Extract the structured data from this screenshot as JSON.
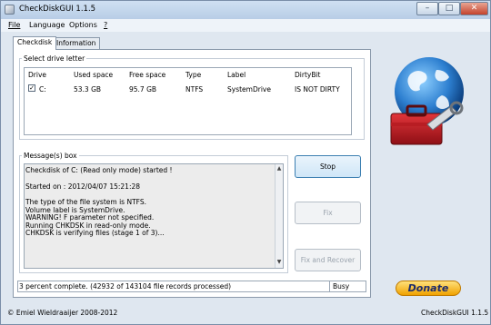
{
  "window": {
    "title": "CheckDiskGUI 1.1.5",
    "min_label": "–",
    "max_label": "□",
    "close_label": "✕"
  },
  "menu": [
    {
      "label": "File",
      "access": "F"
    },
    {
      "label": "Language",
      "access": "L"
    },
    {
      "label": "Options",
      "access": "O"
    },
    {
      "label": "?",
      "access": "?"
    }
  ],
  "tabs": [
    {
      "label": "Checkdisk"
    },
    {
      "label": "Information"
    }
  ],
  "drive_group": {
    "title": "Select drive letter",
    "columns": [
      "Drive",
      "Used space",
      "Free space",
      "Type",
      "Label",
      "DirtyBit"
    ],
    "rows": [
      {
        "checked": true,
        "drive": "C:",
        "used": "53.3 GB",
        "free": "95.7 GB",
        "type": "NTFS",
        "label": "SystemDrive",
        "dirtybit": "IS NOT DIRTY"
      }
    ]
  },
  "message_group": {
    "title": "Message(s) box",
    "lines": [
      "Checkdisk of C: (Read only mode) started !",
      "",
      "Started on : 2012/04/07 15:21:28",
      "",
      "The type of the file system is NTFS.",
      "Volume label is SystemDrive.",
      "WARNING!  F parameter not specified.",
      "Running CHKDSK in read-only mode.",
      "CHKDSK is verifying files (stage 1 of 3)..."
    ]
  },
  "buttons": {
    "stop": "Stop",
    "fix": "Fix",
    "fix_recover": "Fix and Recover"
  },
  "status": {
    "progress_text": "3 percent complete. (42932 of 143104 file records processed)",
    "state": "Busy"
  },
  "donate_label": "Donate",
  "footer": {
    "copyright": "© Emiel Wieldraaijer 2008-2012",
    "version": "CheckDiskGUI 1.1.5"
  },
  "icons": {
    "app": "app-icon",
    "logo": "globe-toolbox-icon"
  }
}
